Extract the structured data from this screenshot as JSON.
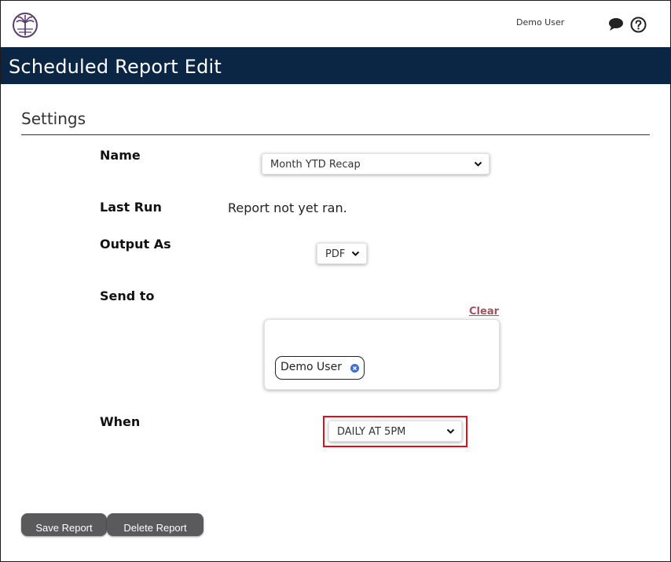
{
  "header": {
    "user_name": "Demo User",
    "chat_icon": "chat-bubble-icon",
    "help_icon": "question-circle-icon",
    "logo_icon": "palm-tree-logo"
  },
  "title_bar": {
    "title": "Scheduled Report Edit",
    "background_color": "#0b2545"
  },
  "settings": {
    "section_title": "Settings",
    "name": {
      "label": "Name",
      "selected": "Month YTD Recap"
    },
    "last_run": {
      "label": "Last Run",
      "value": "Report not yet ran."
    },
    "output_as": {
      "label": "Output As",
      "selected": "PDF"
    },
    "send_to": {
      "label": "Send to",
      "clear_label": "Clear",
      "recipients": [
        "Demo User"
      ]
    },
    "when": {
      "label": "When",
      "selected": "DAILY AT 5PM",
      "highlight_color": "#e0101b"
    }
  },
  "actions": {
    "save_label": "Save Report",
    "delete_label": "Delete Report"
  }
}
